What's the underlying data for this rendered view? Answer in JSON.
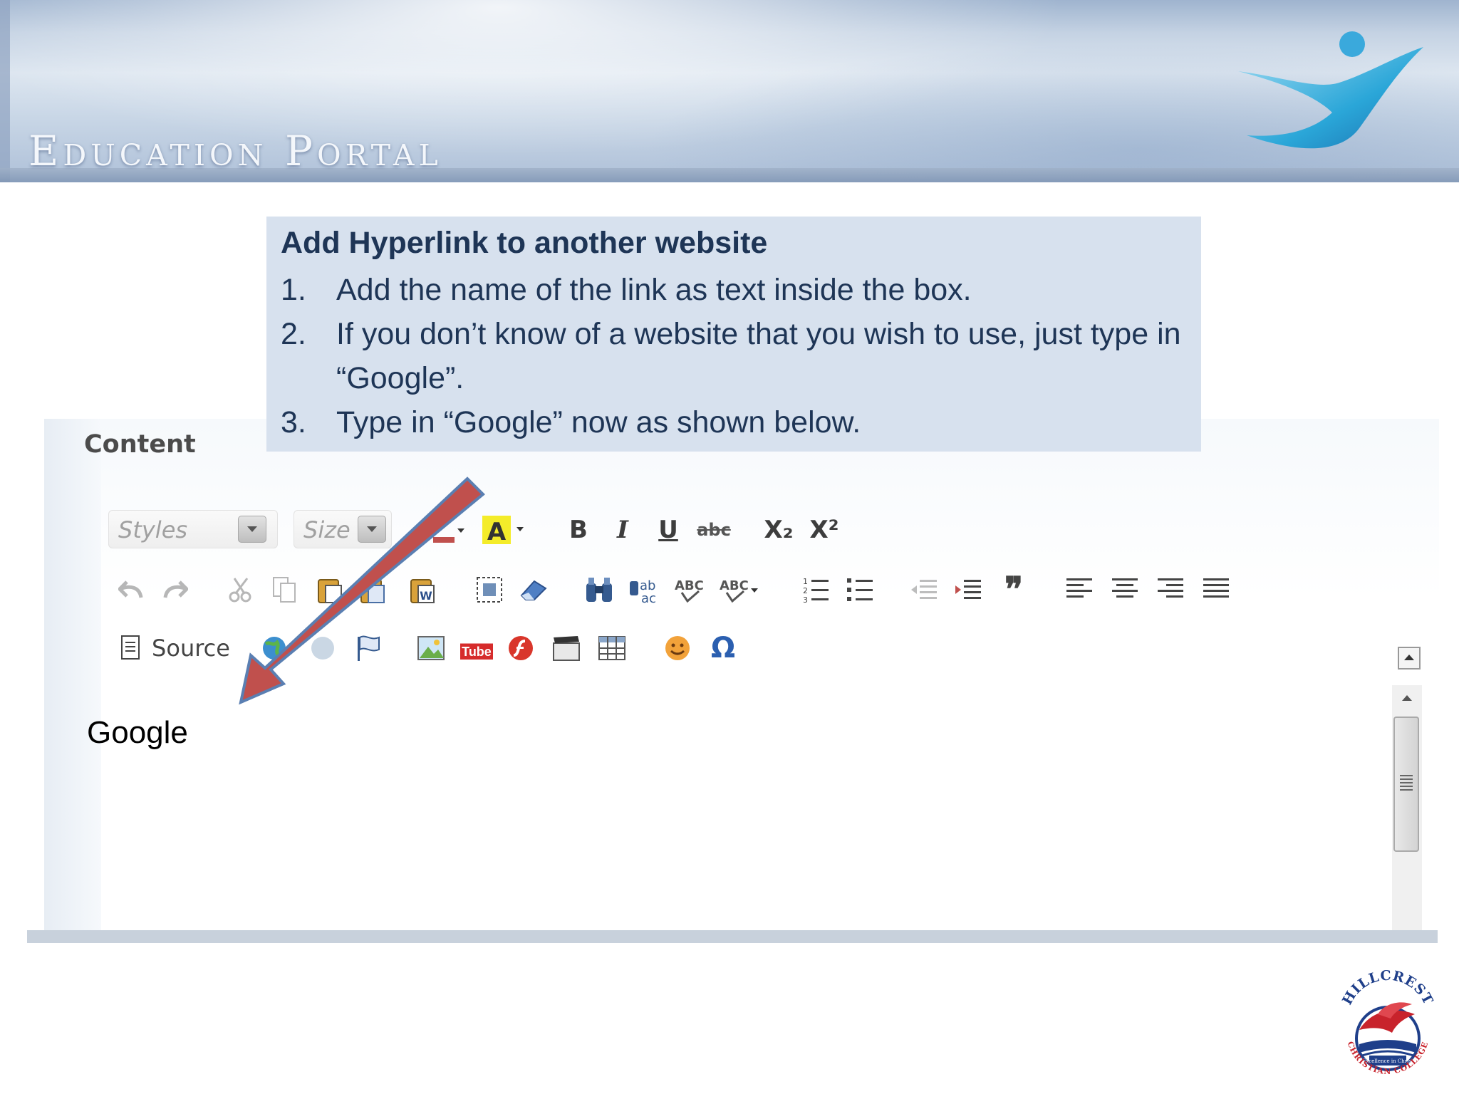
{
  "banner": {
    "title": "Education Portal"
  },
  "instructions": {
    "heading": "Add Hyperlink to another website",
    "steps": [
      {
        "num": "1.",
        "text": "Add the name of the link as text inside the box."
      },
      {
        "num": "2.",
        "text": "If you don’t know of a website that you wish to use, just type in “Google”."
      },
      {
        "num": "3.",
        "text": "Type in “Google” now as shown below."
      }
    ]
  },
  "editor": {
    "label": "Content",
    "styles_combo": "Styles",
    "size_combo": "Size",
    "toolbar": {
      "bold": "B",
      "italic": "I",
      "underline": "U",
      "strike": "abc",
      "subscript": "X₂",
      "superscript": "X²",
      "source": "Source",
      "youtube": "You Tube"
    },
    "typed_text": "Google"
  },
  "logo": {
    "top_text": "HILLCREST",
    "bottom_text": "CHRISTIAN COLLEGE",
    "motto": "Excellence in Christ"
  },
  "colors": {
    "callout_bg": "#d7e1ee",
    "callout_text": "#1e3556",
    "arrow_fill": "#c0504d",
    "arrow_stroke": "#5a7fb2",
    "logo_red": "#c8232c",
    "logo_blue": "#1f3f8a"
  }
}
